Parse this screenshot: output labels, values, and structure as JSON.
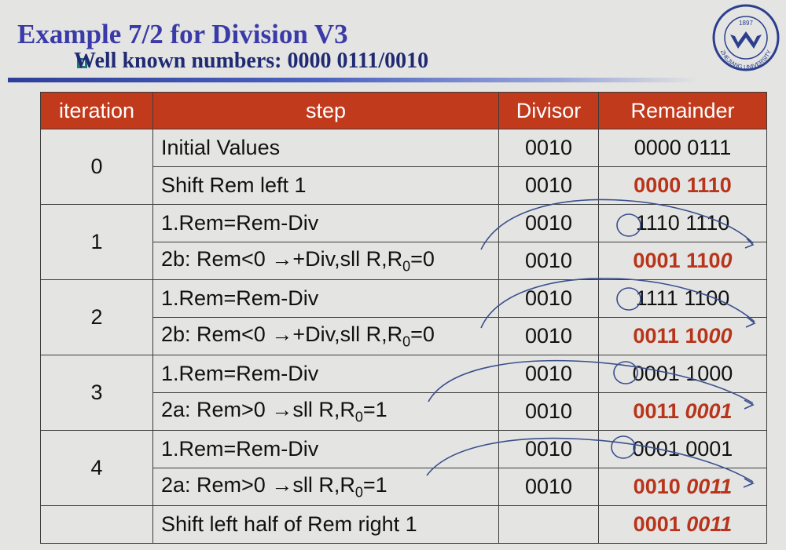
{
  "title": "Example 7/2 for Division V3",
  "subtitle": "Well known numbers: 0000 0111/0010",
  "logo": {
    "text": "ZHEJIANG UNIVERSITY",
    "year": "1897"
  },
  "table": {
    "headers": [
      "iteration",
      "step",
      "Divisor",
      "Remainder"
    ],
    "rows": [
      {
        "iteration": "0",
        "step": "Initial Values",
        "divisor": "0010",
        "rem_a": "0000 0111",
        "rem_b": ""
      },
      {
        "iteration": "",
        "step": "Shift Rem left 1",
        "divisor": "0010",
        "rem_a": "0000 1110",
        "rem_b": ""
      },
      {
        "iteration": "1",
        "step": "1.Rem=Rem-Div",
        "divisor": "0010",
        "rem_a": "1110 1110",
        "rem_b": ""
      },
      {
        "iteration": "",
        "step_pre": "2b: Rem<0 →+Div,sll R,R",
        "step_post": "=0",
        "divisor": "0010",
        "rem_a": "0001 110",
        "rem_b": "0"
      },
      {
        "iteration": "2",
        "step": "1.Rem=Rem-Div",
        "divisor": "0010",
        "rem_a": "1111 1100",
        "rem_b": ""
      },
      {
        "iteration": "",
        "step_pre": "2b: Rem<0 →+Div,sll R,R",
        "step_post": "=0",
        "divisor": "0010",
        "rem_a": "0011 10",
        "rem_b": "00"
      },
      {
        "iteration": "3",
        "step": "1.Rem=Rem-Div",
        "divisor": "0010",
        "rem_a": "0001 1000",
        "rem_b": ""
      },
      {
        "iteration": "",
        "step_pre": "2a: Rem>0 →sll R,R",
        "step_post": "=1",
        "divisor": "0010",
        "rem_a": "0011 ",
        "rem_b": "0001"
      },
      {
        "iteration": "4",
        "step": "1.Rem=Rem-Div",
        "divisor": "0010",
        "rem_a": "0001 0001",
        "rem_b": ""
      },
      {
        "iteration": "",
        "step_pre": "2a: Rem>0 →sll R,R",
        "step_post": "=1",
        "divisor": "0010",
        "rem_a": "0010 ",
        "rem_b": "0011"
      },
      {
        "iteration": "",
        "step": "Shift left half of Rem right 1",
        "divisor": "",
        "rem_a": "0001 ",
        "rem_b": "0011"
      }
    ],
    "subscript": "0"
  },
  "colors": {
    "header_bg": "#c23a1c",
    "title": "#3a3aa8",
    "highlight": "#b8341a",
    "annotation": "#3a4f8c"
  }
}
